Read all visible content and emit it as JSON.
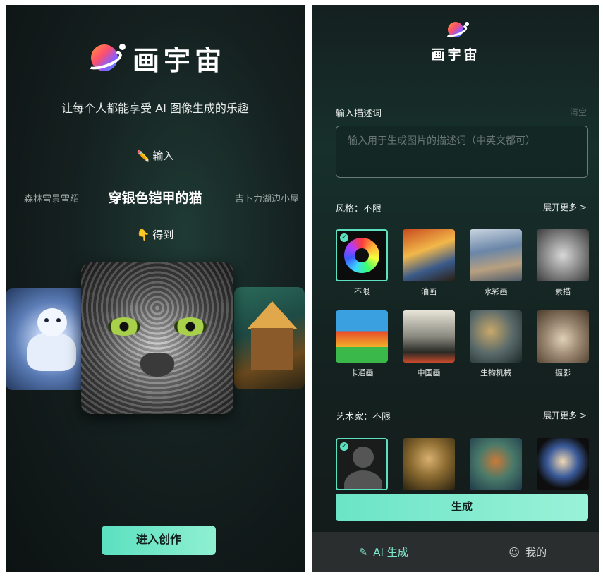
{
  "left": {
    "brand": "画宇宙",
    "slogan": "让每个人都能享受 AI 图像生成的乐趣",
    "step_input": "输入",
    "step_get": "得到",
    "prompt_left": "森林雪景雪貂",
    "prompt_main": "穿银色铠甲的猫",
    "prompt_right": "吉卜力湖边小屋",
    "cta": "进入创作",
    "icons": {
      "input": "pencil-icon",
      "get": "pointing-down-icon"
    }
  },
  "right": {
    "brand": "画宇宙",
    "description": {
      "title": "输入描述词",
      "clear": "清空",
      "placeholder": "输入用于生成图片的描述词（中英文都可）"
    },
    "style": {
      "title": "风格：不限",
      "expand": "展开更多 >",
      "items": [
        {
          "label": "不限",
          "selected": true
        },
        {
          "label": "油画"
        },
        {
          "label": "水彩画"
        },
        {
          "label": "素描"
        },
        {
          "label": "卡通画"
        },
        {
          "label": "中国画"
        },
        {
          "label": "生物机械"
        },
        {
          "label": "摄影"
        }
      ]
    },
    "artist": {
      "title": "艺术家：不限",
      "expand": "展开更多 >"
    },
    "generate": "生成",
    "tabs": [
      {
        "label": "AI 生成",
        "icon": "magic-wand-icon",
        "active": true
      },
      {
        "label": "我的",
        "icon": "user-icon"
      }
    ],
    "colors": {
      "accent": "#5be0c0"
    }
  }
}
